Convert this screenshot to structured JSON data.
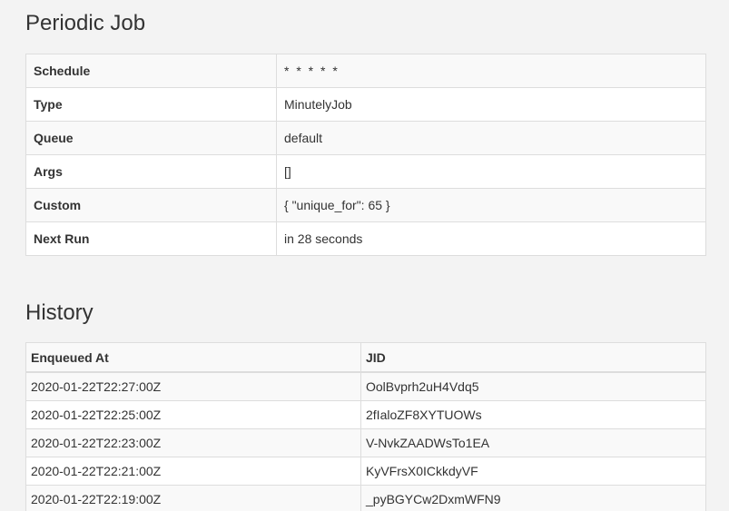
{
  "job": {
    "title": "Periodic Job",
    "rows": [
      {
        "key": "Schedule",
        "value": "* * * * *"
      },
      {
        "key": "Type",
        "value": "MinutelyJob"
      },
      {
        "key": "Queue",
        "value": "default"
      },
      {
        "key": "Args",
        "value": "[]"
      },
      {
        "key": "Custom",
        "value": "{ \"unique_for\": 65 }"
      },
      {
        "key": "Next Run",
        "value": "in 28 seconds"
      }
    ]
  },
  "history": {
    "title": "History",
    "headers": {
      "enqueued_at": "Enqueued At",
      "jid": "JID"
    },
    "rows": [
      {
        "enqueued_at": "2020-01-22T22:27:00Z",
        "jid": "OolBvprh2uH4Vdq5"
      },
      {
        "enqueued_at": "2020-01-22T22:25:00Z",
        "jid": "2fIaloZF8XYTUOWs"
      },
      {
        "enqueued_at": "2020-01-22T22:23:00Z",
        "jid": "V-NvkZAADWsTo1EA"
      },
      {
        "enqueued_at": "2020-01-22T22:21:00Z",
        "jid": "KyVFrsX0ICkkdyVF"
      },
      {
        "enqueued_at": "2020-01-22T22:19:00Z",
        "jid": "_pyBGYCw2DxmWFN9"
      }
    ]
  }
}
